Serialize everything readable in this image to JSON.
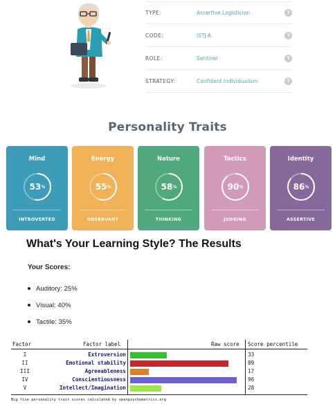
{
  "profile": {
    "rows": [
      {
        "label": "TYPE:",
        "value": "Assertive Logistician"
      },
      {
        "label": "CODE:",
        "value": "ISTJ-A"
      },
      {
        "label": "ROLE:",
        "value": "Sentinel"
      },
      {
        "label": "STRATEGY:",
        "value": "Confident Individualism"
      }
    ],
    "help_glyph": "?",
    "icons": {
      "help": "question-circle-icon",
      "avatar": "logistician-character-illustration"
    }
  },
  "traits": {
    "title": "Personality Traits",
    "cards": [
      {
        "name": "Mind",
        "percent": 53,
        "percent_label": "53",
        "result": "INTROVERTED",
        "color": "#3d9cb8"
      },
      {
        "name": "Energy",
        "percent": 55,
        "percent_label": "55",
        "result": "OBSERVANT",
        "color": "#f1b156"
      },
      {
        "name": "Nature",
        "percent": 58,
        "percent_label": "58",
        "result": "THINKING",
        "color": "#4fa97c"
      },
      {
        "name": "Tactics",
        "percent": 90,
        "percent_label": "90",
        "result": "JUDGING",
        "color": "#d19bb7"
      },
      {
        "name": "Identity",
        "percent": 86,
        "percent_label": "86",
        "result": "ASSERTIVE",
        "color": "#86689b"
      }
    ],
    "percent_sign": "%"
  },
  "learning": {
    "title": "What's Your Learning Style? The Results",
    "subtitle": "Your Scores:",
    "scores": [
      {
        "text": "Auditory: 25%"
      },
      {
        "text": "Visual: 40%"
      },
      {
        "text": "Tactile: 35%"
      }
    ]
  },
  "big_five": {
    "headers": {
      "factor": "Factor",
      "label": "Factor label",
      "raw": "Raw score",
      "percentile": "Score percentile"
    },
    "rows": [
      {
        "num": "I",
        "label": "Extroversion",
        "percentile": 33,
        "percentile_text": "33",
        "color": "#34c234"
      },
      {
        "num": "II",
        "label": "Emotional stability",
        "percentile": 89,
        "percentile_text": "89",
        "color": "#c1272d"
      },
      {
        "num": "III",
        "label": "Agreeableness",
        "percentile": 17,
        "percentile_text": "17",
        "color": "#d9822b"
      },
      {
        "num": "IV",
        "label": "Conscientiousness",
        "percentile": 96,
        "percentile_text": "96",
        "color": "#6b5fd1"
      },
      {
        "num": "V",
        "label": "Intellect/Imagination",
        "percentile": 28,
        "percentile_text": "28",
        "color": "#9be64a"
      }
    ],
    "footer": "Big five personality trait scores calculated by openpsychometrics.org"
  }
}
